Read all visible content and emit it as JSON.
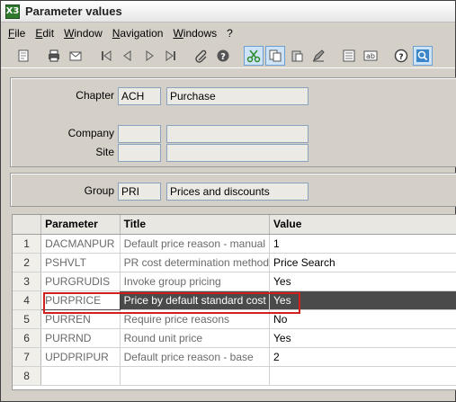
{
  "window": {
    "title": "Parameter values",
    "icon_text": "X3"
  },
  "menu": [
    "File",
    "Edit",
    "Window",
    "Navigation",
    "Windows",
    "?"
  ],
  "toolbar": {
    "icons": [
      "new-icon",
      "print-icon",
      "mail-icon",
      "first-icon",
      "previous-icon",
      "next-icon",
      "last-icon",
      "attachment-icon",
      "help-icon",
      "scissors-icon",
      "copy-icon",
      "paste-icon",
      "edit-icon",
      "list-icon",
      "text-icon",
      "help-circle-icon",
      "search-icon"
    ]
  },
  "chapter": {
    "label": "Chapter",
    "code": "ACH",
    "name": "Purchase"
  },
  "company": {
    "label": "Company",
    "code": "",
    "name": ""
  },
  "site": {
    "label": "Site",
    "code": "",
    "name": ""
  },
  "group": {
    "label": "Group",
    "code": "PRI",
    "name": "Prices and discounts"
  },
  "grid": {
    "headers": [
      "",
      "Parameter",
      "Title",
      "Value"
    ],
    "rows": [
      {
        "num": "1",
        "parameter": "DACMANPUR",
        "title": "Default price reason - manual",
        "value": "1"
      },
      {
        "num": "2",
        "parameter": "PSHVLT",
        "title": "PR cost determination method",
        "value": "Price Search"
      },
      {
        "num": "3",
        "parameter": "PURGRUDIS",
        "title": "Invoke group pricing",
        "value": "Yes"
      },
      {
        "num": "4",
        "parameter": "PURPRICE",
        "title": "Price by default standard cost",
        "value": "Yes"
      },
      {
        "num": "5",
        "parameter": "PURREN",
        "title": "Require price reasons",
        "value": "No"
      },
      {
        "num": "6",
        "parameter": "PURRND",
        "title": "Round unit price",
        "value": "Yes"
      },
      {
        "num": "7",
        "parameter": "UPDPRIPUR",
        "title": "Default price reason - base",
        "value": "2"
      },
      {
        "num": "8",
        "parameter": "",
        "title": "",
        "value": ""
      }
    ],
    "selected_row": 4
  },
  "colors": {
    "highlight": "#d21f1f",
    "selected_bg": "#4a4a4a",
    "app_icon": "#2f7a2f"
  }
}
